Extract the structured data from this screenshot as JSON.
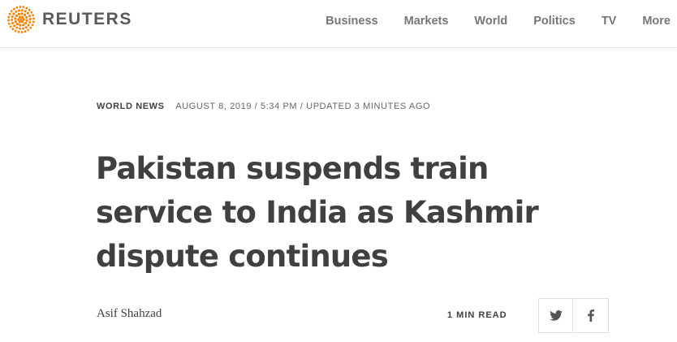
{
  "header": {
    "brand": "REUTERS",
    "brand_color": "#ff8000",
    "logo_icon": "reuters-dot-logo-icon",
    "nav": [
      {
        "label": "Business"
      },
      {
        "label": "Markets"
      },
      {
        "label": "World"
      },
      {
        "label": "Politics"
      },
      {
        "label": "TV"
      },
      {
        "label": "More"
      }
    ]
  },
  "article": {
    "section": "WORLD NEWS",
    "dateline": "AUGUST 8, 2019 / 5:34 PM / UPDATED 3 MINUTES AGO",
    "headline": "Pakistan suspends train service to India as Kashmir dispute continues",
    "author": "Asif Shahzad",
    "read_time": "1 MIN READ",
    "share": [
      {
        "icon": "twitter-icon"
      },
      {
        "icon": "facebook-icon"
      }
    ]
  }
}
